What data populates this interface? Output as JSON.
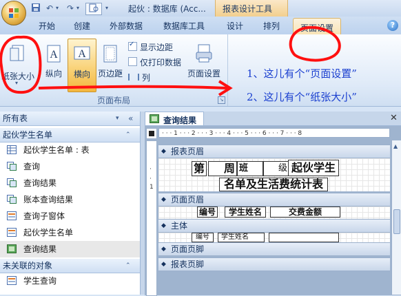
{
  "titlebar": {
    "doc_title": "起伙 : 数据库 (Acc...",
    "context_title": "报表设计工具",
    "quick_access": [
      "save-icon",
      "undo-icon",
      "redo-icon",
      "print-preview-icon"
    ]
  },
  "tabs": [
    "开始",
    "创建",
    "外部数据",
    "数据库工具",
    "设计",
    "排列",
    "页面设置"
  ],
  "ribbon": {
    "group_label": "页面布局",
    "buttons": {
      "paper_size": "纸张大小",
      "portrait": "纵向",
      "landscape": "横向",
      "margins": "页边距",
      "page_setup": "页面设置"
    },
    "checks": [
      {
        "label": "显示边距",
        "checked": true
      },
      {
        "label": "仅打印数据",
        "checked": false
      },
      {
        "label": "列",
        "checked": false
      }
    ]
  },
  "annotations": {
    "note1": "1、这儿有个“页面设置”",
    "note2": "2、这儿有个“纸张大小”"
  },
  "nav": {
    "title": "所有表",
    "group1": "起伙学生名单",
    "group2": "未关联的对象",
    "items": [
      {
        "label": "起伙学生名单 : 表"
      },
      {
        "label": "查询"
      },
      {
        "label": "查询结果"
      },
      {
        "label": "账本查询结果"
      },
      {
        "label": "查询子窗体"
      },
      {
        "label": "起伙学生名单"
      },
      {
        "label": "查询结果"
      }
    ],
    "items2": [
      {
        "label": "学生查询"
      }
    ]
  },
  "document": {
    "tab_title": "查询结果",
    "ruler": "· · · 1 · · · 2 · · · 3 · · · 4 · · · 5 · · · 6 · · · 7 · · · 8",
    "bands": [
      "报表页眉",
      "页面页眉",
      "主体",
      "页面页脚",
      "报表页脚"
    ],
    "header_row1": [
      "第",
      "周",
      "班",
      "级",
      "起伙学生"
    ],
    "header_row2": "名单及生活费统计表",
    "columns": [
      "编号",
      "学生姓名",
      "交费金额"
    ],
    "detail": [
      "编号",
      "学生姓名"
    ]
  },
  "colors": {
    "annotation": "#1a3fd0",
    "highlight_circle": "#ff1010"
  }
}
